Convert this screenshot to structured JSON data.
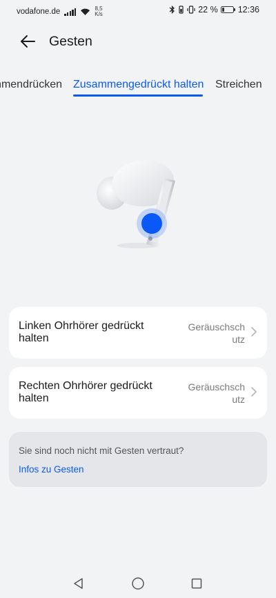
{
  "status_bar": {
    "carrier": "vodafone.de",
    "speed_value": "8,5",
    "speed_unit": "K/s",
    "battery_percent": "22 %",
    "battery_level": 0.22,
    "time": "12:36"
  },
  "header": {
    "title": "Gesten",
    "back_icon": "arrow-left-icon"
  },
  "tabs": [
    {
      "label": "Zweimal zusammendrücken",
      "visible_text": "mmendrücken",
      "active": false
    },
    {
      "label": "Zusammengedrückt halten",
      "active": true
    },
    {
      "label": "Streichen",
      "active": false
    }
  ],
  "settings": [
    {
      "label": "Linken Ohrhörer gedrückt halten",
      "value": "Geräuschschutz"
    },
    {
      "label": "Rechten Ohrhörer gedrückt halten",
      "value": "Geräuschschutz"
    }
  ],
  "info": {
    "text": "Sie sind noch nicht mit Gesten vertraut?",
    "link": "Infos zu Gesten"
  },
  "colors": {
    "accent": "#0a59f7",
    "background": "#f1f3f5",
    "card": "#ffffff",
    "info_box": "#e4e6ea"
  },
  "nav_bar": {
    "back_icon": "triangle-back-icon",
    "home_icon": "circle-home-icon",
    "recent_icon": "square-recent-icon"
  }
}
